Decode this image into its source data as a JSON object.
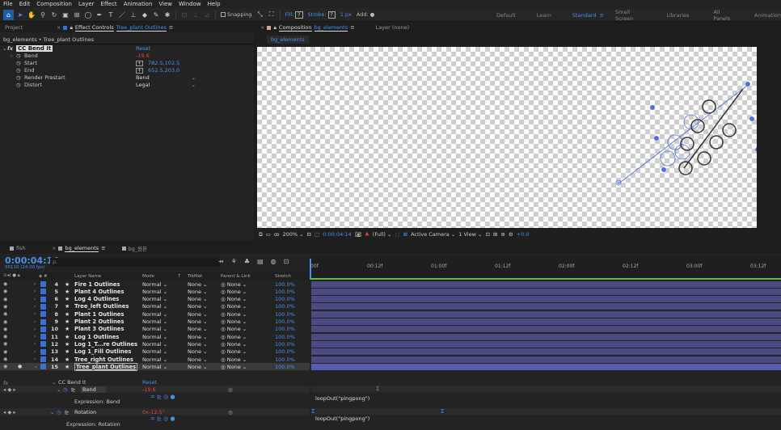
{
  "menu": [
    "File",
    "Edit",
    "Composition",
    "Layer",
    "Effect",
    "Animation",
    "View",
    "Window",
    "Help"
  ],
  "toolbar": {
    "snapping": "Snapping",
    "fill": "Fill:",
    "stroke": "Stroke:",
    "stroke_value": "1 px",
    "add": "Add:",
    "workspaces": [
      "Default",
      "Learn",
      "Standard",
      "Small Screen",
      "Libraries",
      "All Panels",
      "Animation"
    ],
    "active_workspace": "Standard"
  },
  "left_panel": {
    "tab_project": "Project",
    "tab_effect_controls": "Effect Controls",
    "tab_effect_target": "Tree_plant Outlines",
    "breadcrumb": "bg_elements • Tree_plant Outlines",
    "effect": {
      "name": "CC Bend It",
      "reset": "Reset"
    },
    "properties": [
      {
        "name": "Bend",
        "value": "-19.6"
      },
      {
        "name": "Start",
        "value": "782.5,102.5"
      },
      {
        "name": "End",
        "value": "652.5,203.0"
      },
      {
        "name": "Render Prestart",
        "value": "Bend"
      },
      {
        "name": "Distort",
        "value": "Legal"
      }
    ]
  },
  "comp_panel": {
    "tab_composition": "Composition",
    "tab_comp_name": "bg_elements",
    "tab_layer": "Layer (none)",
    "sub_tab": "bg_elements",
    "footer": {
      "zoom": "200%",
      "timecode": "0:00:04:14",
      "resolution": "(Full)",
      "camera": "Active Camera",
      "view": "1 View",
      "exposure": "+0.0"
    }
  },
  "timeline": {
    "tabs": [
      "fish",
      "bg_elements",
      "bg_원본"
    ],
    "active_tab": "bg_elements",
    "timecode": "0:00:04:14",
    "timecode_sub": "00110 (24.00 fps)",
    "search_placeholder": "ρ.",
    "col_headers": {
      "layer_name": "Layer Name",
      "mode": "Mode",
      "t": "T",
      "trkmat": "TrkMat",
      "parent": "Parent & Link",
      "stretch": "Stretch"
    },
    "ruler": [
      "00f",
      "00:12f",
      "01:00f",
      "01:12f",
      "02:00f",
      "02:12f",
      "03:00f",
      "03:12f"
    ],
    "layers": [
      {
        "num": "4",
        "name": "Fire 1 Outlines",
        "mode": "Normal",
        "trkmat": "None",
        "parent": "None",
        "stretch": "100.0%",
        "color": "#3a6fd8"
      },
      {
        "num": "5",
        "name": "Plant 4 Outlines",
        "mode": "Normal",
        "trkmat": "None",
        "parent": "None",
        "stretch": "100.0%",
        "color": "#3a6fd8"
      },
      {
        "num": "6",
        "name": "Log 4 Outlines",
        "mode": "Normal",
        "trkmat": "None",
        "parent": "None",
        "stretch": "100.0%",
        "color": "#3a6fd8"
      },
      {
        "num": "7",
        "name": "Tree_left Outlines",
        "mode": "Normal",
        "trkmat": "None",
        "parent": "None",
        "stretch": "100.0%",
        "color": "#3a6fd8"
      },
      {
        "num": "8",
        "name": "Plant 1 Outlines",
        "mode": "Normal",
        "trkmat": "None",
        "parent": "None",
        "stretch": "100.0%",
        "color": "#3a6fd8"
      },
      {
        "num": "9",
        "name": "Plant 2 Outlines",
        "mode": "Normal",
        "trkmat": "None",
        "parent": "None",
        "stretch": "100.0%",
        "color": "#3a6fd8"
      },
      {
        "num": "10",
        "name": "Plant 3 Outlines",
        "mode": "Normal",
        "trkmat": "None",
        "parent": "None",
        "stretch": "100.0%",
        "color": "#3a6fd8"
      },
      {
        "num": "11",
        "name": "Log 1 Outlines",
        "mode": "Normal",
        "trkmat": "None",
        "parent": "None",
        "stretch": "100.0%",
        "color": "#3a6fd8"
      },
      {
        "num": "12",
        "name": "Log 1_T...re Outlines",
        "mode": "Normal",
        "trkmat": "None",
        "parent": "None",
        "stretch": "100.0%",
        "color": "#3a6fd8"
      },
      {
        "num": "13",
        "name": "Log 1_Fill Outlines",
        "mode": "Normal",
        "trkmat": "None",
        "parent": "None",
        "stretch": "100.0%",
        "color": "#3a6fd8"
      },
      {
        "num": "14",
        "name": "Tree_right Outlines",
        "mode": "Normal",
        "trkmat": "None",
        "parent": "None",
        "stretch": "100.0%",
        "color": "#3a6fd8"
      },
      {
        "num": "15",
        "name": "Tree_plant Outlines",
        "mode": "Normal",
        "trkmat": "None",
        "parent": "None",
        "stretch": "100.0%",
        "color": "#3a6fd8"
      }
    ],
    "effect_rows": {
      "fx_name": "CC Bend It",
      "reset": "Reset",
      "bend_label": "Bend",
      "bend_value": "-19.6",
      "expr_bend_label": "Expression: Bend",
      "expr_bend_text": "loopOut(\"pingpong\")",
      "rotation_label": "Rotation",
      "rotation_value": "0x-12.5°",
      "expr_rotation_label": "Expression: Rotation",
      "expr_rotation_text": "loopOut(\"pingpong\")"
    }
  }
}
